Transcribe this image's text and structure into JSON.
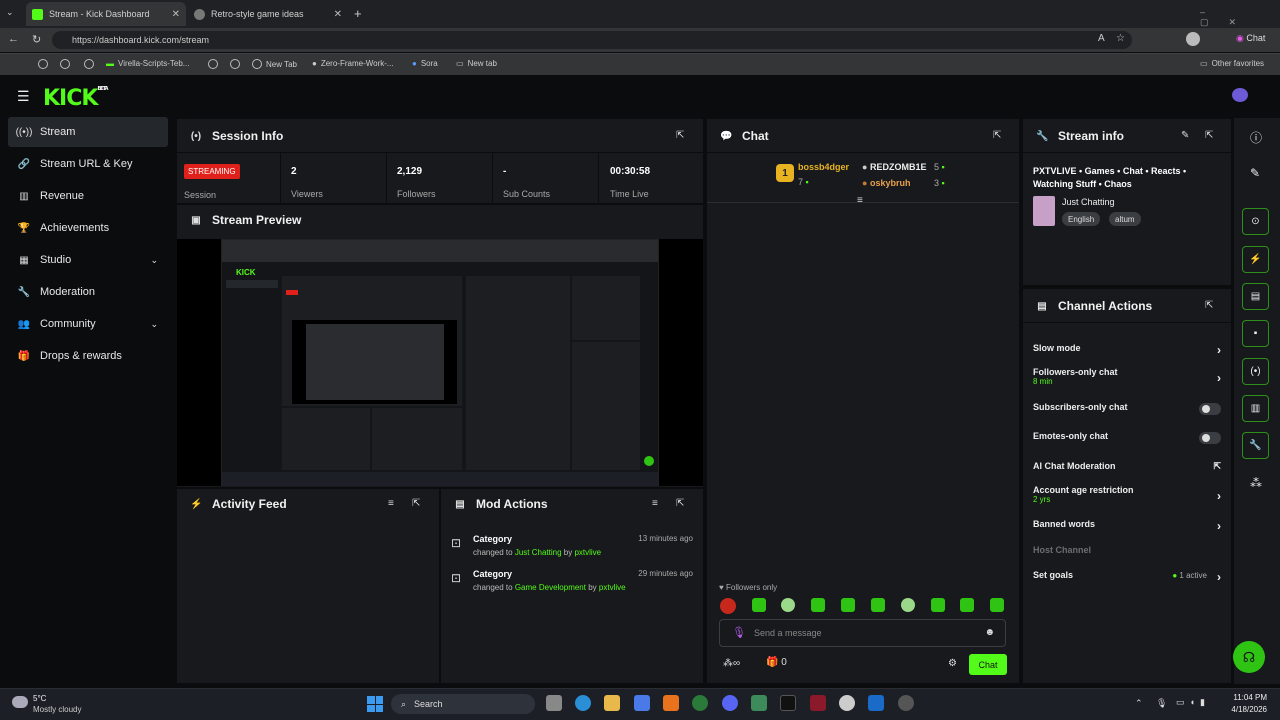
{
  "browser": {
    "tabs": [
      {
        "title": "Stream - Kick Dashboard",
        "active": true
      },
      {
        "title": "Retro-style game ideas",
        "active": false
      }
    ],
    "url": "https://dashboard.kick.com/stream",
    "profile_label": "Chat",
    "bookmarks": [
      "Virella-Scripts-Teb...",
      "New Tab",
      "Zero-Frame-Work-...",
      "Sora",
      "New tab"
    ],
    "other_favorites": "Other favorites"
  },
  "app": {
    "logo": "KICK",
    "logo_badge": "BETA"
  },
  "sidebar": {
    "items": [
      {
        "label": "Stream",
        "icon": "broadcast-icon"
      },
      {
        "label": "Stream URL & Key",
        "icon": "link-icon"
      },
      {
        "label": "Revenue",
        "icon": "chart-icon"
      },
      {
        "label": "Achievements",
        "icon": "trophy-icon"
      },
      {
        "label": "Studio",
        "icon": "grid-icon"
      },
      {
        "label": "Moderation",
        "icon": "wrench-icon"
      },
      {
        "label": "Community",
        "icon": "people-icon"
      },
      {
        "label": "Drops & rewards",
        "icon": "gift-icon"
      }
    ]
  },
  "session": {
    "title": "Session Info",
    "status": "STREAMING",
    "status_label": "Session",
    "stats": [
      {
        "value": "2",
        "label": "Viewers"
      },
      {
        "value": "2,129",
        "label": "Followers"
      },
      {
        "value": "-",
        "label": "Sub Counts"
      },
      {
        "value": "00:30:58",
        "label": "Time Live"
      }
    ]
  },
  "preview": {
    "title": "Stream Preview"
  },
  "activity": {
    "title": "Activity Feed"
  },
  "mod_actions": {
    "title": "Mod Actions",
    "items": [
      {
        "type": "Category",
        "time": "13 minutes ago",
        "prefix": "changed to",
        "target": "Just Chatting",
        "by": "by",
        "user": "pxtvlive"
      },
      {
        "type": "Category",
        "time": "29 minutes ago",
        "prefix": "changed to",
        "target": "Game Development",
        "by": "by",
        "user": "pxtvlive"
      }
    ]
  },
  "chat": {
    "title": "Chat",
    "leaderboard": [
      {
        "rank": "1",
        "name": "bossb4dger",
        "count": "7"
      },
      {
        "name": "REDZOMB1E",
        "count": "5"
      },
      {
        "name": "oskybruh",
        "count": "3"
      }
    ],
    "mode": "Followers only",
    "placeholder": "Send a message",
    "viewers_count": "0",
    "send_label": "Chat"
  },
  "stream_info": {
    "title": "Stream info",
    "stream_title": "PXTVLIVE • Games • Chat • Reacts • Watching Stuff • Chaos",
    "category": "Just Chatting",
    "tags": [
      "English",
      "altum"
    ]
  },
  "channel_actions": {
    "title": "Channel Actions",
    "slow_mode": "Slow mode",
    "followers_only": "Followers-only chat",
    "followers_only_sub": "8 min",
    "subs_only": "Subscribers-only chat",
    "emotes_only": "Emotes-only chat",
    "ai_moderation": "AI Chat Moderation",
    "account_age": "Account age restriction",
    "account_age_sub": "2 yrs",
    "banned_words": "Banned words",
    "host_channel": "Host Channel",
    "set_goals": "Set goals",
    "set_goals_status": "1 active"
  },
  "taskbar": {
    "weather_temp": "5°C",
    "weather_desc": "Mostly cloudy",
    "search": "Search",
    "time": "11:04 PM",
    "date": "4/18/2026"
  },
  "colors": {
    "accent": "#53fc18",
    "live": "#e0201a",
    "panel": "#17191c"
  }
}
